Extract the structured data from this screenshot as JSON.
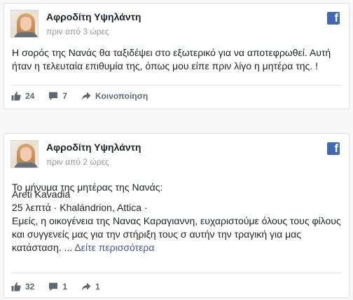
{
  "posts": [
    {
      "author": "Αφροδίτη Υψηλάντη",
      "time": "πριν από 3 ώρες",
      "text": "Η σορός της Νανάς θα ταξιδέψει στο εξωτερικό για να αποτεφρωθεί. Αυτή ήταν η τελευταία επιθυμία της, όπως μου είπε πριν λίγο η μητέρα της. !",
      "likes": "24",
      "comments": "7",
      "share_label": "Κοινοποίηση",
      "icons": [
        "like-icon",
        "comment-icon",
        "share-icon",
        "facebook-icon"
      ]
    },
    {
      "author": "Αφροδίτη Υψηλάντη",
      "time": "πριν από 2 ώρες",
      "intro": "Το μήνυμα της μητέρας της Νανάς:",
      "quoted_author": "Areti Kavadia",
      "quoted_meta": "25 λεπτά · Khalándrion, Attica ·",
      "quoted_text_line1": "Εμείς, η οικογένεια της Νανας Καραγιαννη, ευχαριστούμε όλους τους φίλους",
      "quoted_text_line2": "και συγγενείς μας για την στήριξη τους σ αυτήν την τραγική για μας",
      "quoted_text_line3": "κατάσταση. ...",
      "see_more": "Δείτε περισσότερα",
      "likes": "32",
      "comments": "1",
      "shares": "1",
      "icons": [
        "like-icon",
        "comment-icon",
        "share-icon",
        "facebook-icon"
      ]
    }
  ],
  "colors": {
    "facebook_blue": "#4267b2",
    "link": "#365899",
    "muted": "#90949c",
    "action_text": "#616770"
  }
}
